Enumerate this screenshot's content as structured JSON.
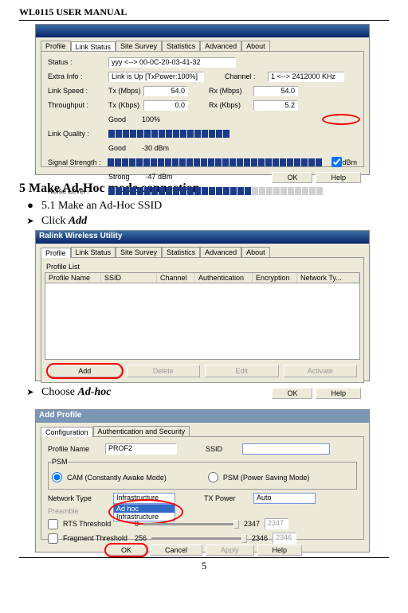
{
  "doc": {
    "header": "WL0115 USER MANUAL",
    "section_title": "5 Make Ad-Hoc mode connection",
    "b1": "5.1 Make an Ad-Hoc SSID",
    "b2": "Click ",
    "b2b": "Add",
    "b3": "Choose ",
    "b3b": "Ad-hoc",
    "page_num": "5"
  },
  "ss1": {
    "tabs": {
      "profile": "Profile",
      "linkstatus": "Link Status",
      "sitesurvey": "Site Survey",
      "statistics": "Statistics",
      "advanced": "Advanced",
      "about": "About"
    },
    "labels": {
      "status": "Status :",
      "extra": "Extra Info :",
      "speed": "Link Speed :",
      "thru": "Throughput :",
      "quality": "Link Quality :",
      "signal": "Signal Strength :",
      "noise": "Noise Level :",
      "channel": "Channel :"
    },
    "vals": {
      "status": "yyy <--> 00-0C-20-03-41-32",
      "extra": "Link is Up [TxPower:100%]",
      "channel": "1 <--> 2412000 KHz",
      "txm": "Tx (Mbps)",
      "txmv": "54.0",
      "rxm": "Rx (Mbps)",
      "rxmv": "54.0",
      "txk": "Tx (Kbps)",
      "txkv": "0.0",
      "rxk": "Rx (Kbps)",
      "rxkv": "5.2",
      "good": "Good",
      "g100": "100%",
      "sigv": "-30 dBm",
      "strong": "Strong",
      "noisev": "-47 dBm",
      "dbm": "dBm"
    },
    "btn_ok": "OK",
    "btn_help": "Help"
  },
  "ss2": {
    "title": "Ralink Wireless Utility",
    "tabs": {
      "profile": "Profile",
      "linkstatus": "Link Status",
      "sitesurvey": "Site Survey",
      "statistics": "Statistics",
      "advanced": "Advanced",
      "about": "About"
    },
    "grouplabel": "Profile List",
    "cols": {
      "c1": "Profile Name",
      "c2": "SSID",
      "c3": "Channel",
      "c4": "Authentication",
      "c5": "Encryption",
      "c6": "Network Ty..."
    },
    "btn_add": "Add",
    "btn_del": "Delete",
    "btn_edit": "Edit",
    "btn_act": "Activate",
    "btn_ok": "OK",
    "btn_help": "Help"
  },
  "ss3": {
    "title": "Add Profile",
    "tabs": {
      "config": "Configuration",
      "auth": "Authentication and Security"
    },
    "lbl_profile": "Profile Name",
    "val_profile": "PROF2",
    "lbl_ssid": "SSID",
    "psm_group": "PSM",
    "cam": "CAM (Constantly Awake Mode)",
    "psm": "PSM (Power Saving Mode)",
    "lbl_net": "Network Type",
    "dd_val": "Infrastructure",
    "dd_opt1": "Ad hoc",
    "dd_opt2": "Infrastructure",
    "lbl_tx": "TX Power",
    "tx_val": "Auto",
    "lbl_pre": "Preamble",
    "rts": "RTS Threshold",
    "rts_min": "0",
    "rts_max": "2347",
    "rts_v": "2347",
    "frag": "Fragment Threshold",
    "frag_min": "256",
    "frag_max": "2346",
    "frag_v": "2346",
    "btn_ok": "OK",
    "btn_cancel": "Cancel",
    "btn_apply": "Apply",
    "btn_help": "Help"
  }
}
